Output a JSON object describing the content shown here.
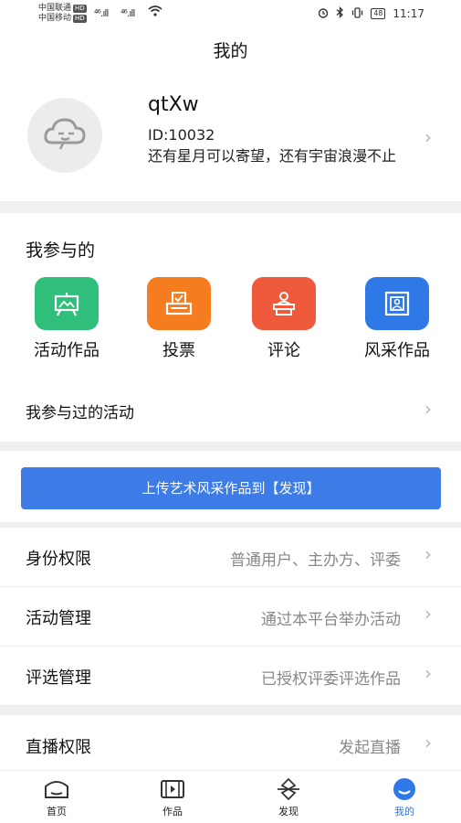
{
  "status_bar": {
    "carrier1": "中国联通",
    "carrier2": "中国移动",
    "hd": "HD",
    "signal1": "⁴⁶.ıll",
    "signal2": "⁴⁶.ıll",
    "battery": "48",
    "time": "11:17"
  },
  "header": {
    "title": "我的"
  },
  "profile": {
    "username": "qtXw",
    "id": "ID:10032",
    "motto": "还有星月可以寄望，还有宇宙浪漫不止"
  },
  "participation": {
    "title": "我参与的",
    "items": [
      {
        "label": "活动作品",
        "icon": "easel-icon",
        "color": "#2fbf7a"
      },
      {
        "label": "投票",
        "icon": "ballot-box-icon",
        "color": "#f57c1f"
      },
      {
        "label": "评论",
        "icon": "podium-speaker-icon",
        "color": "#ef5a3c"
      },
      {
        "label": "风采作品",
        "icon": "framed-picture-icon",
        "color": "#2f78e8"
      }
    ],
    "joined_activities": "我参与过的活动"
  },
  "upload": {
    "button_label": "上传艺术风采作品到【发现】"
  },
  "settings": [
    {
      "label": "身份权限",
      "value": "普通用户、主办方、评委"
    },
    {
      "label": "活动管理",
      "value": "通过本平台举办活动"
    },
    {
      "label": "评选管理",
      "value": "已授权评委评选作品"
    }
  ],
  "live": {
    "label": "直播权限",
    "value": "发起直播"
  },
  "tabs": [
    {
      "label": "首页",
      "icon": "home-icon"
    },
    {
      "label": "作品",
      "icon": "film-icon"
    },
    {
      "label": "发现",
      "icon": "discover-icon"
    },
    {
      "label": "我的",
      "icon": "profile-icon",
      "active": true
    }
  ],
  "colors": {
    "accent": "#2f78e8",
    "button": "#3d7be6"
  }
}
